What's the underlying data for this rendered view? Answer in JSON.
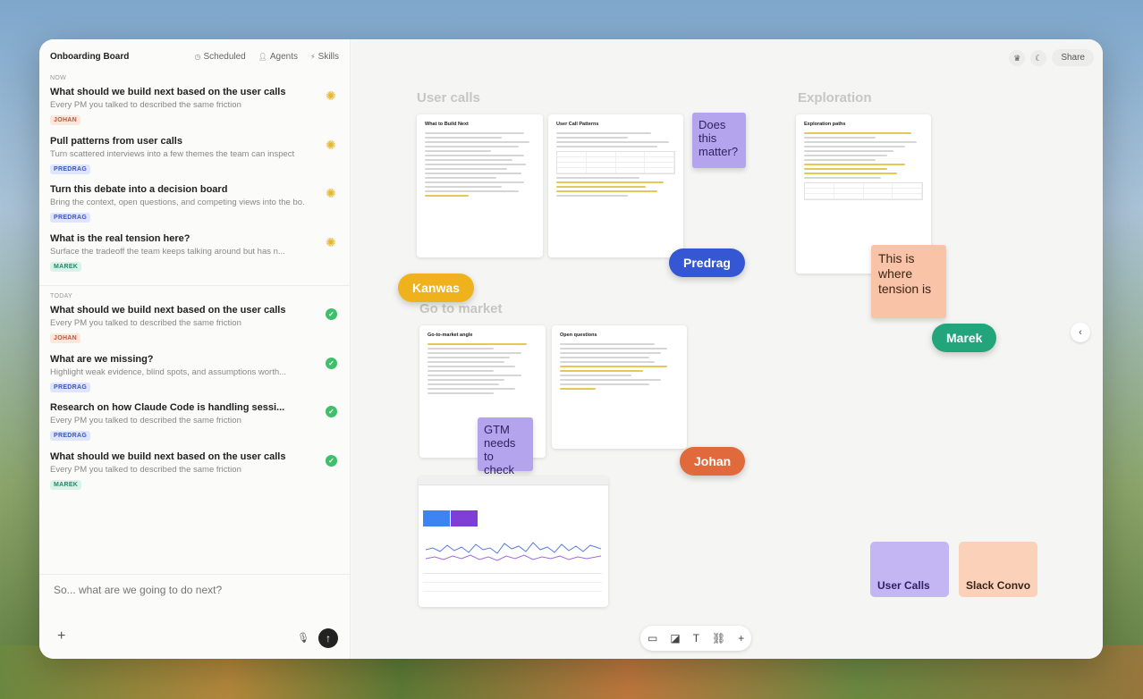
{
  "sidebar": {
    "board_title": "Onboarding Board",
    "header_links": [
      {
        "icon": "clock-icon",
        "label": "Scheduled"
      },
      {
        "icon": "user-icon",
        "label": "Agents"
      },
      {
        "icon": "bolt-icon",
        "label": "Skills"
      }
    ],
    "sections": {
      "now": "NOW",
      "today": "TODAY"
    },
    "now_tasks": [
      {
        "title": "What should we build next based on the user calls",
        "subtitle": "Every PM you talked to described the same friction",
        "tag": "JOHAN",
        "status": "in-progress"
      },
      {
        "title": "Pull patterns from user calls",
        "subtitle": "Turn scattered interviews into a few themes the team can inspect",
        "tag": "PREDRAG",
        "status": "in-progress"
      },
      {
        "title": "Turn this debate into a decision board",
        "subtitle": "Bring the context, open questions, and competing views into the bo...",
        "tag": "PREDRAG",
        "status": "in-progress"
      },
      {
        "title": "What is the real tension here?",
        "subtitle": "Surface the tradeoff the team keeps talking around but has n...",
        "tag": "MAREK",
        "status": "in-progress"
      }
    ],
    "today_tasks": [
      {
        "title": "What should we build next based on the user calls",
        "subtitle": "Every PM you talked to described the same friction",
        "tag": "JOHAN",
        "status": "done"
      },
      {
        "title": "What are we missing?",
        "subtitle": "Highlight weak evidence, blind spots, and assumptions worth...",
        "tag": "PREDRAG",
        "status": "done"
      },
      {
        "title": "Research on how Claude Code is handling sessi...",
        "subtitle": "Every PM you talked to described the same friction",
        "tag": "PREDRAG",
        "status": "done"
      },
      {
        "title": "What should we build next based on the user calls",
        "subtitle": "Every PM you talked to described the same friction",
        "tag": "MAREK",
        "status": "done"
      }
    ],
    "composer": {
      "placeholder": "So... what are we going to do next?"
    }
  },
  "canvas": {
    "share_label": "Share",
    "groups": {
      "user_calls": "User calls",
      "exploration": "Exploration",
      "go_to_market": "Go to market"
    },
    "docs": {
      "what_to_build": "What to Build Next",
      "user_call_patterns": "User Call Patterns",
      "exploration_paths": "Exploration paths",
      "gtm_angle": "Go-to-market angle",
      "open_questions": "Open questions"
    },
    "stickies": {
      "does_this_matter": "Does this matter?",
      "where_tension_is": "This is where tension is",
      "gtm_check": "GTM needs to check"
    },
    "cursors": {
      "kanwas": "Kanwas",
      "predrag": "Predrag",
      "marek": "Marek",
      "johan": "Johan"
    },
    "folders": {
      "user_calls": "User Calls",
      "slack_convo": "Slack Convo"
    },
    "toolbar_tools": [
      "doc-icon",
      "sticky-icon",
      "text-icon",
      "link-icon",
      "plus-icon"
    ]
  },
  "colors": {
    "kanwas": "#efb21c",
    "predrag": "#3557d4",
    "marek": "#23a57c",
    "johan": "#e06a3c",
    "sticky_purple": "#b4a4ee",
    "sticky_peach": "#f9c3a7"
  }
}
